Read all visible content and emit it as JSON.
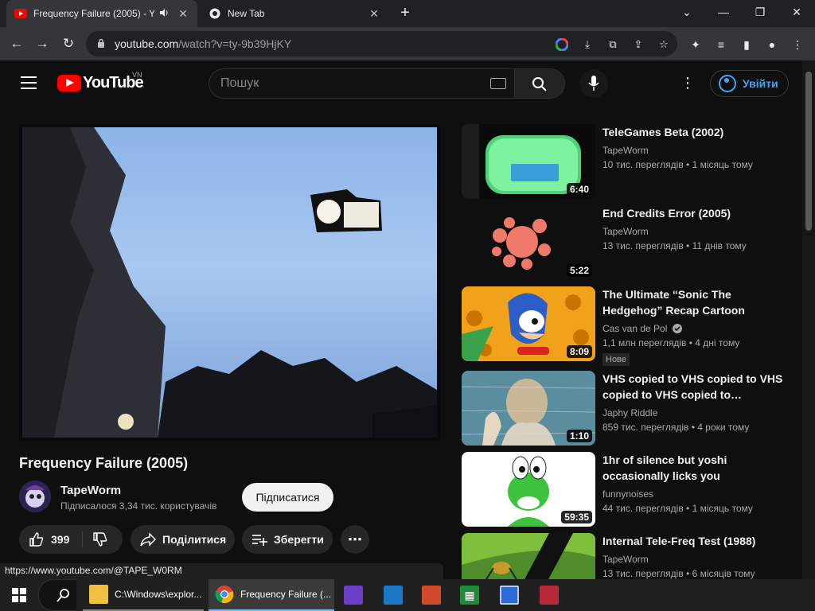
{
  "browser": {
    "tabs": [
      {
        "title": "Frequency Failure (2005) - Y",
        "active": true
      },
      {
        "title": "New Tab",
        "active": false
      }
    ],
    "url_host": "youtube.com",
    "url_path": "/watch?v=ty-9b39HjKY"
  },
  "masthead": {
    "logo_text": "YouTube",
    "country_code": "VN",
    "search_placeholder": "Пошук",
    "signin_label": "Увійти"
  },
  "video": {
    "title": "Frequency Failure (2005)",
    "channel": "TapeWorm",
    "subscribers": "Підписалося 3,34 тис. користувачів",
    "subscribe_label": "Підписатися",
    "likes": "399",
    "share_label": "Поділитися",
    "save_label": "Зберегти"
  },
  "status_url": "https://www.youtube.com/@TAPE_W0RM",
  "related": [
    {
      "title": "TeleGames Beta (2002)",
      "channel": "TapeWorm",
      "meta": "10 тис. переглядів  • 1 місяць тому",
      "duration": "6:40",
      "verified": false,
      "badge": ""
    },
    {
      "title": "End Credits Error (2005)",
      "channel": "TapeWorm",
      "meta": "13 тис. переглядів  • 11 днів тому",
      "duration": "5:22",
      "verified": false,
      "badge": ""
    },
    {
      "title": "The Ultimate “Sonic The Hedgehog” Recap Cartoon",
      "channel": "Cas van de Pol",
      "meta": "1,1 млн переглядів  • 4 дні тому",
      "duration": "8:09",
      "verified": true,
      "badge": "Нове"
    },
    {
      "title": "VHS copied to VHS copied to VHS copied to VHS copied to…",
      "channel": "Japhy Riddle",
      "meta": "859 тис. переглядів  • 4 роки тому",
      "duration": "1:10",
      "verified": false,
      "badge": ""
    },
    {
      "title": "1hr of silence but yoshi occasionally licks you",
      "channel": "funnynoises",
      "meta": "44 тис. переглядів  • 1 місяць тому",
      "duration": "59:35",
      "verified": false,
      "badge": ""
    },
    {
      "title": "Internal Tele-Freq Test (1988)",
      "channel": "TapeWorm",
      "meta": "13 тис. переглядів  • 6 місяців тому",
      "duration": "",
      "verified": false,
      "badge": ""
    }
  ],
  "taskbar": {
    "explorer_label": "C:\\Windows\\explor...",
    "chrome_label": "Frequency Failure (..."
  }
}
